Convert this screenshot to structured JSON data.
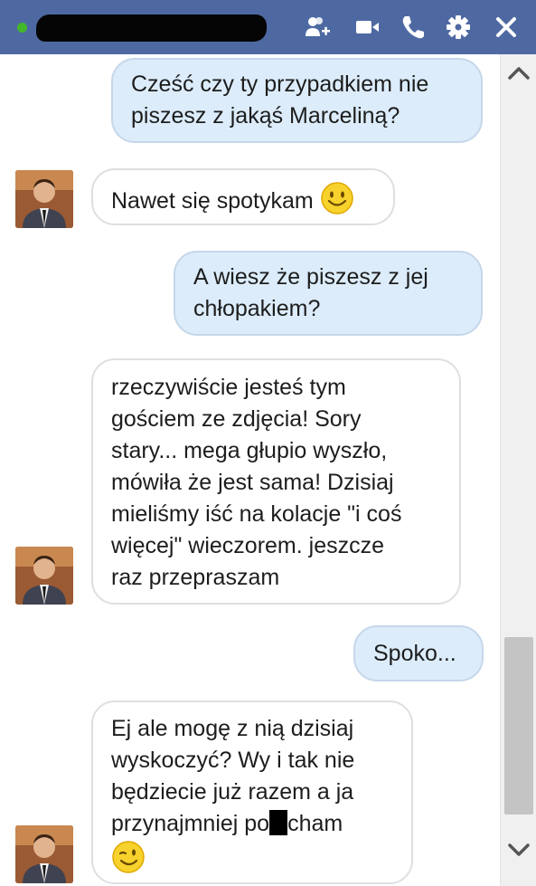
{
  "header": {
    "online_color": "#42b72a",
    "name_redacted": true,
    "icons": [
      "add-friend-icon",
      "video-call-icon",
      "phone-icon",
      "gear-icon",
      "close-icon"
    ]
  },
  "messages": [
    {
      "direction": "out",
      "lines": [
        "Cześć czy ty przypadkiem nie",
        "piszesz z jakąś Marceliną?"
      ]
    },
    {
      "direction": "in",
      "lines": [
        "Nawet się spotykam"
      ],
      "emoji": "smile-emoji"
    },
    {
      "direction": "out",
      "lines": [
        "A wiesz że piszesz z jej",
        "chłopakiem?"
      ]
    },
    {
      "direction": "in",
      "lines": [
        "rzeczywiście jesteś tym",
        "gościem ze zdjęcia! Sory",
        "stary... mega głupio wyszło,",
        "mówiła że jest sama! Dzisiaj",
        "mieliśmy iść na kolacje \"i coś",
        "więcej\" wieczorem. jeszcze",
        "raz przepraszam"
      ]
    },
    {
      "direction": "out",
      "lines": [
        "Spoko..."
      ]
    },
    {
      "direction": "in",
      "lines": [
        "Ej ale mogę z nią dzisiaj",
        "wyskoczyć? Wy i tak nie",
        "będziecie już razem a ja"
      ],
      "last_line_before": "przynajmniej po",
      "last_line_after": "cham",
      "emoji": "wink-emoji"
    }
  ],
  "colors": {
    "header": "#4e69a2",
    "outgoing_bubble": "#dcecfa",
    "incoming_bubble": "#ffffff"
  }
}
